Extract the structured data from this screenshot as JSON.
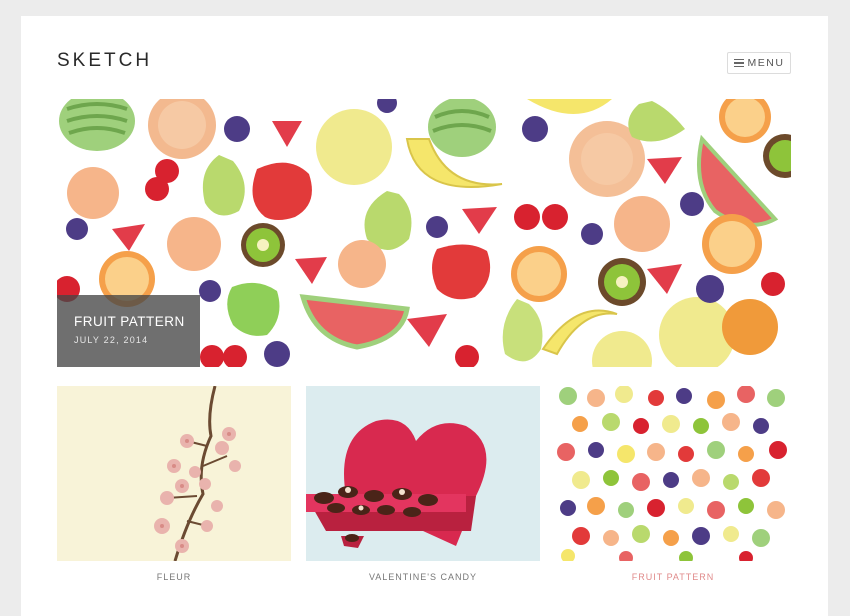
{
  "header": {
    "site_title": "SKETCH",
    "menu_label": "MENU"
  },
  "featured": {
    "title": "FRUIT PATTERN",
    "date": "JULY 22, 2014"
  },
  "posts": [
    {
      "title": "FLEUR"
    },
    {
      "title": "VALENTINE'S CANDY"
    },
    {
      "title": "FRUIT PATTERN"
    }
  ],
  "colors": {
    "page_bg": "#ececec",
    "card_bg": "#ffffff",
    "accent_link": "#e08a8a",
    "caption_overlay": "#464646"
  }
}
